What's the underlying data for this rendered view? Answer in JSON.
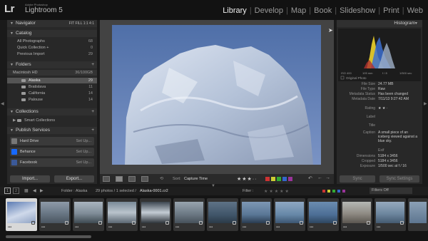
{
  "app": {
    "logo": "Lr",
    "brand_line1": "Adobe Photoshop",
    "brand_line2": "Lightroom 5"
  },
  "modules": [
    "Library",
    "Develop",
    "Map",
    "Book",
    "Slideshow",
    "Print",
    "Web"
  ],
  "active_module": "Library",
  "navigator": {
    "title": "Navigator",
    "zoom_options": [
      "FIT",
      "FILL",
      "1:1",
      "4:1"
    ]
  },
  "catalog": {
    "title": "Catalog",
    "items": [
      {
        "label": "All Photographs",
        "count": "68"
      },
      {
        "label": "Quick Collection +",
        "count": "0"
      },
      {
        "label": "Previous Import",
        "count": "29"
      }
    ]
  },
  "folders": {
    "title": "Folders",
    "volume": "Macintosh HD",
    "volume_size": "36/100GB",
    "items": [
      {
        "label": "Alaska",
        "count": "29"
      },
      {
        "label": "Bratislava",
        "count": "11"
      },
      {
        "label": "California",
        "count": "14"
      },
      {
        "label": "Palouse",
        "count": "14"
      }
    ]
  },
  "collections": {
    "title": "Collections",
    "items": [
      {
        "label": "Smart Collections"
      }
    ]
  },
  "publish": {
    "title": "Publish Services",
    "items": [
      {
        "label": "Hard Drive",
        "action": "Set Up..."
      },
      {
        "label": "Behance",
        "action": "Set Up..."
      },
      {
        "label": "Facebook",
        "action": "Set Up..."
      }
    ]
  },
  "left_buttons": {
    "import": "Import...",
    "export": "Export..."
  },
  "toolbar": {
    "sort_label": "Sort:",
    "sort_value": "Capture Time"
  },
  "filmbar": {
    "source": "Folder : Alaska",
    "info": "29 photos / 1 selected /",
    "filename": "Alaska-0001.cr2",
    "filter_label": "Filter :",
    "filter_value": "Filters Off",
    "pages": [
      "1",
      "2"
    ]
  },
  "histogram": {
    "title": "Histogram",
    "iso": "ISO 400",
    "focal": "105 mm",
    "aperture": "f / 8",
    "shutter": "1/500 sec",
    "original": "Original Photo"
  },
  "metadata": [
    {
      "label": "File Size",
      "value": "24.77 MB"
    },
    {
      "label": "File Type",
      "value": "Raw"
    },
    {
      "label": "Metadata Status",
      "value": "Has been changed"
    },
    {
      "label": "Metadata Date",
      "value": "7/11/13 9:27:42 AM"
    },
    {
      "label": "Rating",
      "value": "★ ★ ·"
    },
    {
      "label": "Label",
      "value": ""
    },
    {
      "label": "Title",
      "value": ""
    },
    {
      "label": "Caption",
      "value": "A small piece of an iceberg viewed against a blue sky."
    },
    {
      "label": "Exif",
      "value": ""
    },
    {
      "label": "Dimensions",
      "value": "5184 x 3456"
    },
    {
      "label": "Cropped",
      "value": "5184 x 3456"
    },
    {
      "label": "Exposure",
      "value": "1/500 sec at f / 16"
    }
  ],
  "right_buttons": {
    "sync": "Sync",
    "sync_settings": "Sync Settings"
  }
}
